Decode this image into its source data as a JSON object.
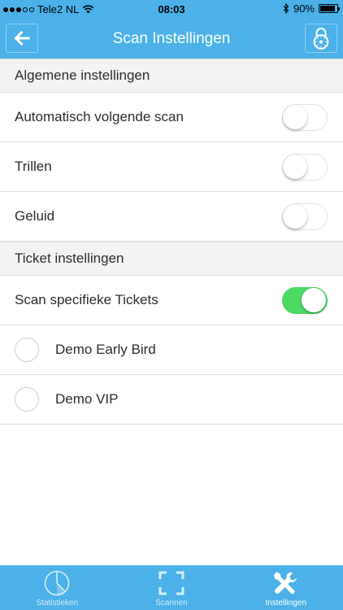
{
  "status_bar": {
    "carrier": "Tele2 NL",
    "time": "08:03",
    "battery": "90%",
    "battery_level": 0.9,
    "signal_bars_filled": 3,
    "signal_bars_total": 5
  },
  "nav": {
    "title": "Scan Instellingen",
    "back_icon": "arrow-left-icon",
    "lock_icon": "lock-icon"
  },
  "sections": {
    "general": {
      "title": "Algemene instellingen",
      "items": [
        {
          "label": "Automatisch volgende scan",
          "enabled": false
        },
        {
          "label": "Trillen",
          "enabled": false
        },
        {
          "label": "Geluid",
          "enabled": false
        }
      ]
    },
    "tickets": {
      "title": "Ticket instellingen",
      "scan_specific": {
        "label": "Scan specifieke Tickets",
        "enabled": true
      },
      "ticket_types": [
        {
          "label": "Demo Early Bird",
          "selected": false
        },
        {
          "label": "Demo VIP",
          "selected": false
        }
      ]
    }
  },
  "tabbar": {
    "tabs": [
      {
        "label": "Statistieken",
        "icon": "pie-chart-icon",
        "active": false
      },
      {
        "label": "Scannen",
        "icon": "scan-frame-icon",
        "active": false
      },
      {
        "label": "Instellingen",
        "icon": "tools-icon",
        "active": true
      }
    ]
  },
  "colors": {
    "accent": "#4bb1e8",
    "toggle_on": "#4cd964",
    "section_bg": "#f3f3f3",
    "divider": "#dcdcdc"
  }
}
